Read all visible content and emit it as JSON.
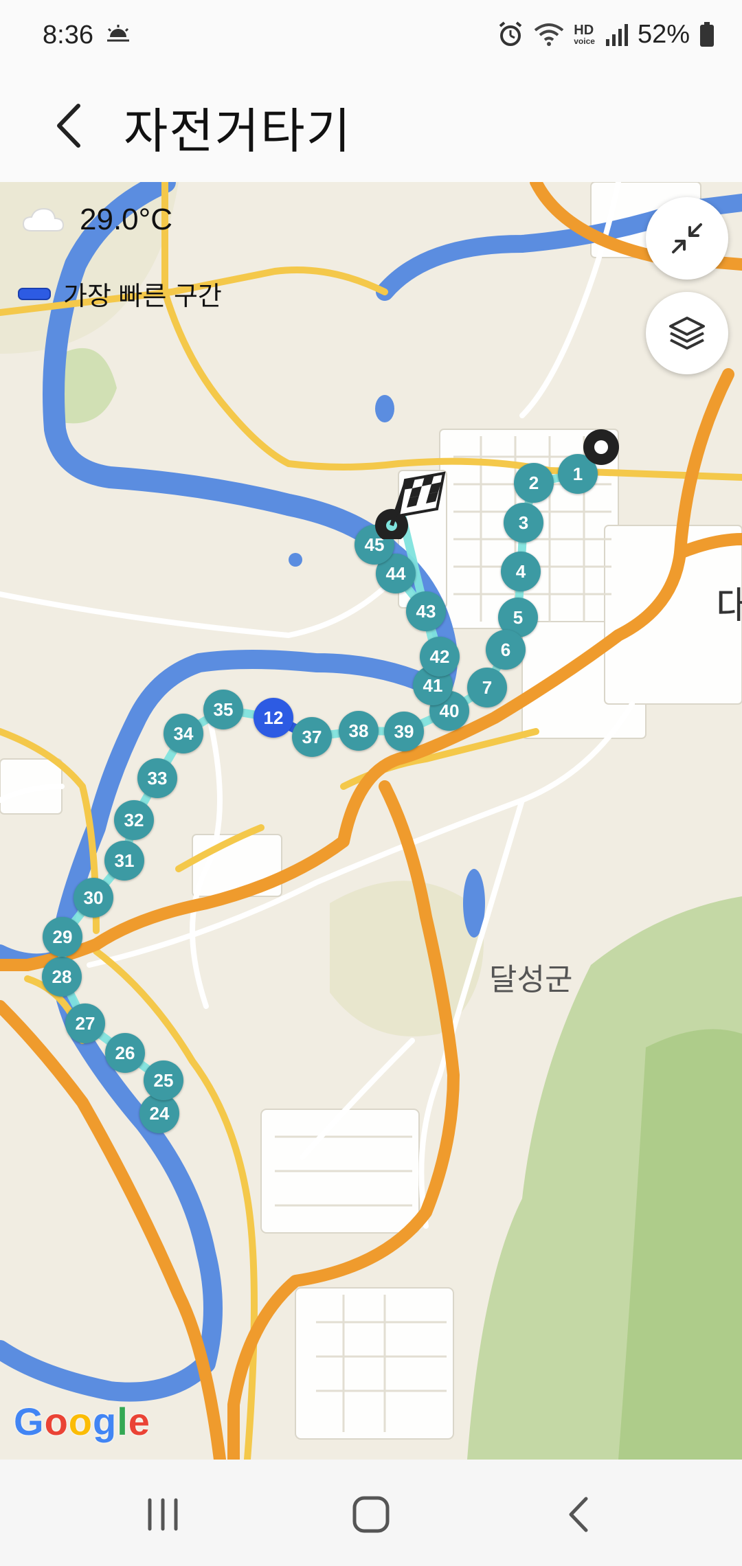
{
  "status_bar": {
    "time": "8:36",
    "weather_icon": "sun-haze-icon",
    "icons": [
      "alarm-icon",
      "wifi-icon",
      "hd-voice-icon",
      "signal-icon",
      "battery-icon"
    ],
    "hd_label": "HD",
    "voice_label": "voice",
    "battery_percent": "52%"
  },
  "header": {
    "back_icon": "chevron-left-icon",
    "title": "자전거타기"
  },
  "map": {
    "weather": {
      "icon": "cloud-icon",
      "temperature": "29.0°C"
    },
    "legend": {
      "color": "#2d5be3",
      "label": "가장 빠른 구간"
    },
    "buttons": {
      "collapse_icon": "collapse-arrows-icon",
      "layers_icon": "layers-icon"
    },
    "area_label": "달성군",
    "edge_label": "대",
    "attribution": "Google",
    "route_color": "#7fe3dd",
    "marker_color": "#3c9aa3",
    "fastest_marker_color": "#2d5be3",
    "start_icon": "start-point-icon",
    "finish_icon": "checkered-flag-icon",
    "markers": [
      {
        "label": "1",
        "fastest": false
      },
      {
        "label": "2",
        "fastest": false
      },
      {
        "label": "3",
        "fastest": false
      },
      {
        "label": "4",
        "fastest": false
      },
      {
        "label": "5",
        "fastest": false
      },
      {
        "label": "6",
        "fastest": false
      },
      {
        "label": "7",
        "fastest": false
      },
      {
        "label": "12",
        "fastest": true
      },
      {
        "label": "24",
        "fastest": false
      },
      {
        "label": "25",
        "fastest": false
      },
      {
        "label": "26",
        "fastest": false
      },
      {
        "label": "27",
        "fastest": false
      },
      {
        "label": "28",
        "fastest": false
      },
      {
        "label": "29",
        "fastest": false
      },
      {
        "label": "30",
        "fastest": false
      },
      {
        "label": "31",
        "fastest": false
      },
      {
        "label": "32",
        "fastest": false
      },
      {
        "label": "33",
        "fastest": false
      },
      {
        "label": "34",
        "fastest": false
      },
      {
        "label": "35",
        "fastest": false
      },
      {
        "label": "37",
        "fastest": false
      },
      {
        "label": "38",
        "fastest": false
      },
      {
        "label": "39",
        "fastest": false
      },
      {
        "label": "40",
        "fastest": false
      },
      {
        "label": "41",
        "fastest": false
      },
      {
        "label": "42",
        "fastest": false
      },
      {
        "label": "43",
        "fastest": false
      },
      {
        "label": "44",
        "fastest": false
      },
      {
        "label": "45",
        "fastest": false
      }
    ]
  },
  "nav_bar": {
    "recents_icon": "recents-icon",
    "home_icon": "home-icon",
    "back_icon": "back-icon"
  }
}
